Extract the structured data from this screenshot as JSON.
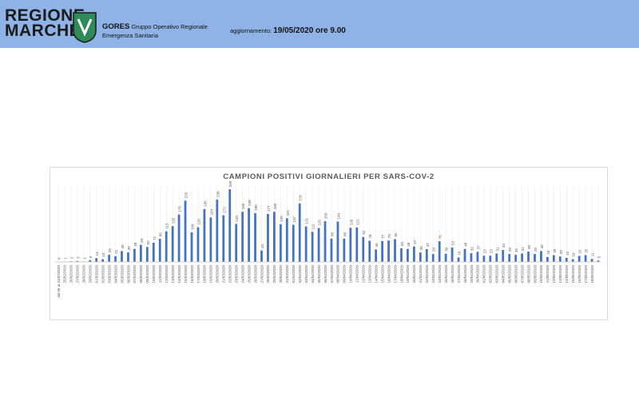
{
  "header": {
    "brand_line1": "REGIONE",
    "brand_line2": "MARCHE",
    "org_name": "GORES",
    "org_line1": "Gruppo Operativo Regionale",
    "org_line2": "Emergenza Sanitaria",
    "update_label": "aggiornamento:",
    "update_value": "19/05/2020 ore 9.00",
    "colors": {
      "band": "#8fb3e6",
      "logo": "#2e8b57"
    }
  },
  "chart_data": {
    "type": "bar",
    "title": "CAMPIONI POSITIVI GIORNALIERI PER SARS-COV-2",
    "color": "#4472c4",
    "grid": true,
    "ylim": [
      0,
      280
    ],
    "categories": [
      "dal 06 al 24/02/2020",
      "25/02/2020",
      "26/02/2020",
      "27/02/2020",
      "28/02/2020",
      "29/02/2020",
      "01/03/2020",
      "02/03/2020",
      "03/03/2020",
      "04/03/2020",
      "05/03/2020",
      "06/03/2020",
      "07/03/2020",
      "08/03/2020",
      "09/03/2020",
      "10/03/2020",
      "11/03/2020",
      "12/03/2020",
      "13/03/2020",
      "14/03/2020",
      "15/03/2020",
      "16/03/2020",
      "17/03/2020",
      "18/03/2020",
      "19/03/2020",
      "20/03/2020",
      "21/03/2020",
      "22/03/2020",
      "23/03/2020",
      "24/03/2020",
      "25/03/2020",
      "26/03/2020",
      "27/03/2020",
      "28/03/2020",
      "29/03/2020",
      "30/03/2020",
      "31/03/2020",
      "01/04/2020",
      "02/04/2020",
      "03/04/2020",
      "04/04/2020",
      "05/04/2020",
      "06/04/2020",
      "07/04/2020",
      "08/04/2020",
      "09/04/2020",
      "10/04/2020",
      "11/04/2020",
      "12/04/2020",
      "13/04/2020",
      "14/04/2020",
      "15/04/2020",
      "16/04/2020",
      "17/04/2020",
      "18/04/2020",
      "19/04/2020",
      "20/04/2020",
      "21/04/2020",
      "22/04/2020",
      "23/04/2020",
      "24/04/2020",
      "25/04/2020",
      "26/04/2020",
      "27/04/2020",
      "28/04/2020",
      "29/04/2020",
      "30/04/2020",
      "01/05/2020",
      "02/05/2020",
      "03/05/2020",
      "04/05/2020",
      "05/05/2020",
      "06/05/2020",
      "07/05/2020",
      "08/05/2020",
      "09/05/2020",
      "10/05/2020",
      "11/05/2020",
      "12/05/2020",
      "13/05/2020",
      "14/05/2020",
      "15/05/2020",
      "16/05/2020",
      "17/05/2020",
      "18/05/2020"
    ],
    "values": [
      0,
      1,
      2,
      3,
      1,
      6,
      14,
      10,
      26,
      21,
      40,
      35,
      48,
      63,
      55,
      71,
      85,
      113,
      132,
      175,
      226,
      109,
      128,
      195,
      164,
      230,
      172,
      268,
      140,
      185,
      198,
      180,
      42,
      177,
      185,
      139,
      161,
      137,
      216,
      131,
      111,
      125,
      150,
      86,
      149,
      86,
      126,
      127,
      92,
      78,
      46,
      77,
      79,
      84,
      50,
      48,
      57,
      35,
      47,
      29,
      76,
      30,
      53,
      16,
      48,
      32,
      37,
      23,
      23,
      31,
      44,
      29,
      26,
      31,
      38,
      29,
      40,
      18,
      25,
      20,
      15,
      10,
      22,
      25,
      11,
      5
    ]
  }
}
